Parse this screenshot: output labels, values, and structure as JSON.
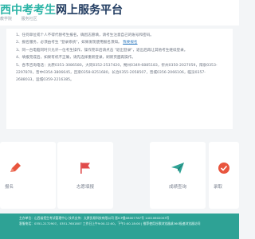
{
  "header": {
    "brand_accent": "西中考考生",
    "brand_main": "网上服务平台",
    "subnav": [
      "教学院",
      "服务社区"
    ]
  },
  "notice": {
    "items": [
      "1、任何单位或个人不得代替考生报名，确因志愿填，请考生注意自己的账号和密码。",
      "2、报名服务，必须由考生 \"登录系统\"，如果发现使用报名须知。",
      "3、同一台电脑同时只允许一位考生操作，操作完毕后请点击 \"退出登录\"，退出后再让其他考生继续登录。",
      "4、填报完成后，如果有机不正确，请先选择重新登录，刷新页面再操作。",
      "5、各市咨询电话：太原0351-3086580，大同0352-2537420，朔州0349-6885183，忻州0350-2027059，阳泉0353-2297870，晋中0354-3806645，吕梁0358-8251680，长治0355-2058507，晋城0356-2066106，临汾0357-2688033，运城0359-2216385。"
    ],
    "link_text": "我要报名"
  },
  "cards": [
    {
      "label": "报名"
    },
    {
      "label": "志愿填报"
    },
    {
      "label": "成绩查询"
    },
    {
      "label": "录取"
    }
  ],
  "footer": {
    "line1": "主办单位：山西省招生考试管理中心    技术支持：太原优易科技有限公司    晋ICP备08007787号    14010602003号",
    "line2": "客服电话：0351-2172907，0351-7601807 工作日上午9:00-12:00，下午2:00-18:00  |  推荐使用谷歌浏览器或360极速浏览器访问"
  }
}
